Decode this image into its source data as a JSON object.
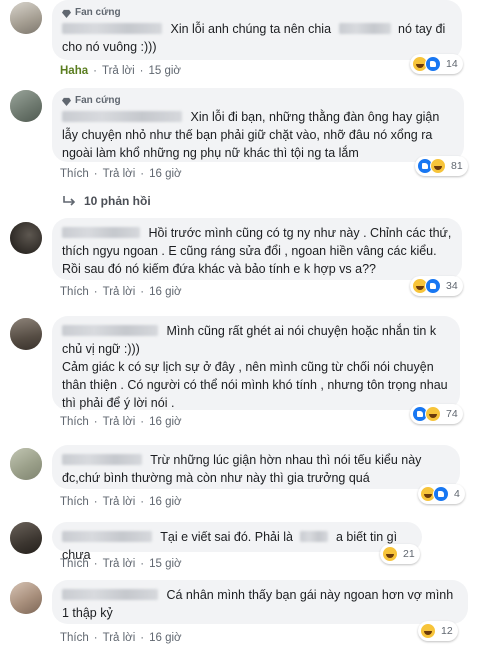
{
  "comments": [
    {
      "badge": "Fan cứng",
      "text_before": "Xin lỗi anh chúng ta nên chia",
      "text_after": "nó tay đi cho nó vuông :)))",
      "actions": {
        "reaction_label": "Haha",
        "reply": "Trả lời",
        "time": "15 giờ"
      },
      "reaction_count": "14"
    },
    {
      "badge": "Fan cứng",
      "text": "Xin lỗi đi bạn, những thằng đàn ông hay giận lẫy chuyện nhỏ như thế bạn phải giữ chặt vào, nhỡ đâu nó xổng ra ngoài làm khổ những ng phụ nữ khác thì tội ng ta lắm",
      "actions": {
        "like": "Thích",
        "reply": "Trả lời",
        "time": "16 giờ"
      },
      "reaction_count": "81",
      "replies_label": "10 phản hồi"
    },
    {
      "text": "Hồi trước mình cũng có tg ny như này . Chỉnh các thứ, thích ngyu ngoan . E cũng ráng sửa đổi , ngoan hiền vâng các kiểu. Rồi sau đó nó kiếm đứa khác và bảo tính e k hợp vs a??",
      "actions": {
        "like": "Thích",
        "reply": "Trả lời",
        "time": "16 giờ"
      },
      "reaction_count": "34"
    },
    {
      "text": "Mình cũng rất ghét ai nói chuyện hoặc nhắn tin k chủ vị ngữ :)))",
      "text2": "Cảm giác k có sự lịch sự ở đây , nên mình cũng từ chối nói chuyện thân thiện . Có người có thể nói mình khó tính , nhưng tôn trọng nhau thì phải để ý lời nói .",
      "actions": {
        "like": "Thích",
        "reply": "Trả lời",
        "time": "16 giờ"
      },
      "reaction_count": "74"
    },
    {
      "text": "Trừ những lúc giận hờn nhau thì nói tếu kiểu này đc,chứ bình thường mà còn như này thì gia trưởng quá",
      "actions": {
        "like": "Thích",
        "reply": "Trả lời",
        "time": "16 giờ"
      },
      "reaction_count": "4"
    },
    {
      "text_before": "Tại e viết sai đó. Phải là",
      "text_after": "a biết tin gì chưa",
      "actions": {
        "like": "Thích",
        "reply": "Trả lời",
        "time": "15 giờ"
      },
      "reaction_count": "21"
    },
    {
      "text": "Cá nhân mình thấy bạn gái này ngoan hơn vợ mình 1 thập kỷ",
      "actions": {
        "like": "Thích",
        "reply": "Trả lời",
        "time": "16 giờ"
      },
      "reaction_count": "12"
    }
  ],
  "colors": {
    "bubble": "#f2f3f5",
    "action_text": "#606770",
    "haha_label": "#5a7d1f",
    "like_blue": "#1877f2",
    "haha_yellow": "#f7c43a"
  },
  "icons": [
    "diamond-icon",
    "haha-reaction-icon",
    "like-reaction-icon",
    "reply-arrow-icon"
  ]
}
